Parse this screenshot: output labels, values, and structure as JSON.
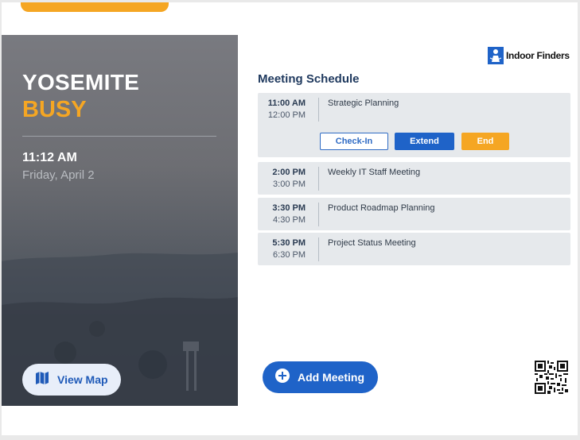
{
  "room": {
    "name": "YOSEMITE",
    "status": "BUSY"
  },
  "clock": {
    "time": "11:12 AM",
    "date": "Friday, April 2"
  },
  "left_panel": {
    "view_map_label": "View Map",
    "map_icon": "map-icon"
  },
  "brand": {
    "name": "Indoor Finders",
    "logo_icon": "indoor-finders-logo-icon"
  },
  "schedule": {
    "title": "Meeting Schedule",
    "meetings": [
      {
        "start": "11:00 AM",
        "end": "12:00 PM",
        "title": "Strategic Planning"
      },
      {
        "start": "2:00 PM",
        "end": "3:00 PM",
        "title": "Weekly IT Staff Meeting"
      },
      {
        "start": "3:30 PM",
        "end": "4:30 PM",
        "title": "Product Roadmap Planning"
      },
      {
        "start": "5:30 PM",
        "end": "6:30 PM",
        "title": "Project Status Meeting"
      }
    ],
    "actions": {
      "checkin": "Check-In",
      "extend": "Extend",
      "end": "End"
    }
  },
  "add_meeting": {
    "label": "Add Meeting",
    "icon": "plus-circle-icon"
  },
  "qr": {
    "icon": "qr-code-icon"
  },
  "colors": {
    "accent_orange": "#f5a623",
    "primary_blue": "#1f63c8",
    "title_navy": "#203a5f",
    "card_bg": "#e6e9ec"
  }
}
